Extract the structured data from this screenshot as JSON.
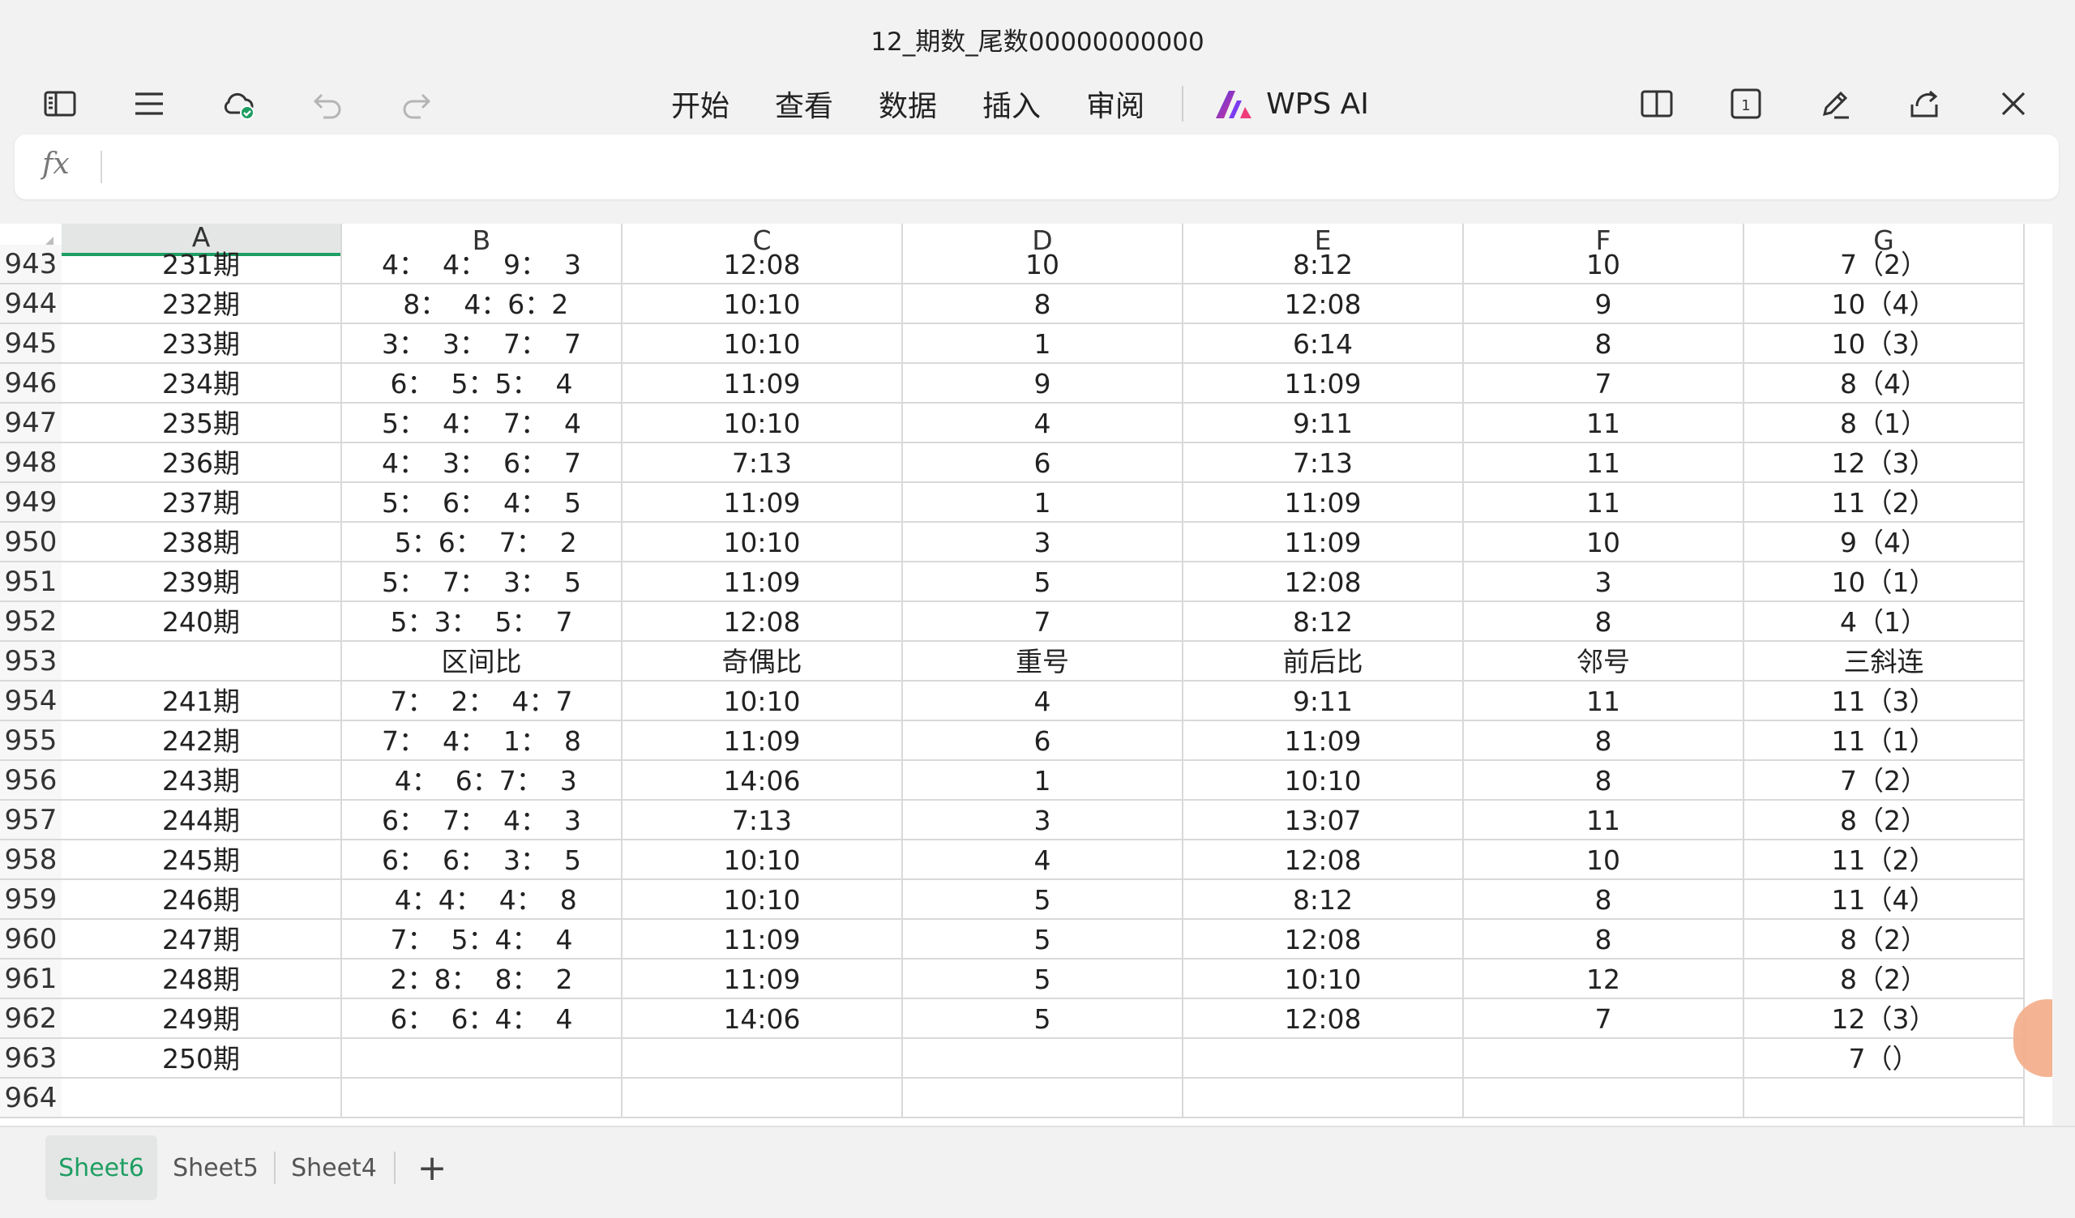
{
  "title": "12_期数_尾数00000000000",
  "toolbar": {
    "left_icons": [
      "sidebar-icon",
      "menu-icon",
      "cloud-sync-icon",
      "undo-icon",
      "redo-icon"
    ],
    "menu": [
      "开始",
      "查看",
      "数据",
      "插入",
      "审阅"
    ],
    "ai_label": "WPS AI",
    "right_icons": [
      "split-view-icon",
      "page-count-icon",
      "edit-pen-icon",
      "share-icon",
      "close-icon"
    ],
    "page_count": "1",
    "accent": "#1e9e63"
  },
  "formula_bar": {
    "fx_label": "fx",
    "value": ""
  },
  "columns": [
    "A",
    "B",
    "C",
    "D",
    "E",
    "F",
    "G"
  ],
  "active_column": "A",
  "rows": [
    {
      "n": "943",
      "cells": [
        "231期",
        "4：  4：  9：  3",
        "12:08",
        "10",
        "8:12",
        "10",
        "7（2）"
      ]
    },
    {
      "n": "944",
      "cells": [
        "232期",
        " 8：  4：6：2",
        "10:10",
        "8",
        "12:08",
        "9",
        "10（4）"
      ]
    },
    {
      "n": "945",
      "cells": [
        "233期",
        "3：  3：  7：  7",
        "10:10",
        "1",
        "6:14",
        "8",
        "10（3）"
      ]
    },
    {
      "n": "946",
      "cells": [
        "234期",
        "6：  5：5：  4",
        "11:09",
        "9",
        "11:09",
        "7",
        "8（4）"
      ]
    },
    {
      "n": "947",
      "cells": [
        "235期",
        "5：  4：  7：  4",
        "10:10",
        "4",
        "9:11",
        "11",
        "8（1）"
      ]
    },
    {
      "n": "948",
      "cells": [
        "236期",
        "4：  3：  6：  7",
        "7:13",
        "6",
        "7:13",
        "11",
        "12（3）"
      ]
    },
    {
      "n": "949",
      "cells": [
        "237期",
        "5：  6：  4：  5",
        "11:09",
        "1",
        "11:09",
        "11",
        "11（2）"
      ]
    },
    {
      "n": "950",
      "cells": [
        "238期",
        " 5：6：  7：  2",
        "10:10",
        "3",
        "11:09",
        "10",
        "9（4）"
      ]
    },
    {
      "n": "951",
      "cells": [
        "239期",
        "5：  7：  3：  5",
        "11:09",
        "5",
        "12:08",
        "3",
        "10（1）"
      ]
    },
    {
      "n": "952",
      "cells": [
        "240期",
        "5：3：  5：  7",
        "12:08",
        "7",
        "8:12",
        "8",
        "4（1）"
      ]
    },
    {
      "n": "953",
      "cells": [
        "",
        "区间比",
        "奇偶比",
        "重号",
        "前后比",
        "邻号",
        "三斜连"
      ]
    },
    {
      "n": "954",
      "cells": [
        "241期",
        "7：  2：  4：7",
        "10:10",
        "4",
        "9:11",
        "11",
        "11（3）"
      ]
    },
    {
      "n": "955",
      "cells": [
        "242期",
        "7：  4：  1：  8",
        "11:09",
        "6",
        "11:09",
        "8",
        "11（1）"
      ]
    },
    {
      "n": "956",
      "cells": [
        "243期",
        " 4：  6：7：  3",
        "14:06",
        "1",
        "10:10",
        "8",
        "7（2）"
      ]
    },
    {
      "n": "957",
      "cells": [
        "244期",
        "6：  7：  4：  3",
        "7:13",
        "3",
        "13:07",
        "11",
        "8（2）"
      ]
    },
    {
      "n": "958",
      "cells": [
        "245期",
        "6：  6：  3：  5",
        "10:10",
        "4",
        "12:08",
        "10",
        "11（2）"
      ]
    },
    {
      "n": "959",
      "cells": [
        "246期",
        " 4：4：  4：  8",
        "10:10",
        "5",
        "8:12",
        "8",
        "11（4）"
      ]
    },
    {
      "n": "960",
      "cells": [
        "247期",
        "7：  5：4：  4",
        "11:09",
        "5",
        "12:08",
        "8",
        "8（2）"
      ]
    },
    {
      "n": "961",
      "cells": [
        "248期",
        "2：8：  8：  2",
        "11:09",
        "5",
        "10:10",
        "12",
        "8（2）"
      ]
    },
    {
      "n": "962",
      "cells": [
        "249期",
        "6：  6：4：  4",
        "14:06",
        "5",
        "12:08",
        "7",
        "12（3）"
      ]
    },
    {
      "n": "963",
      "cells": [
        "250期",
        "",
        "",
        "",
        "",
        "",
        "7（）"
      ]
    },
    {
      "n": "964",
      "cells": [
        "",
        "",
        "",
        "",
        "",
        "",
        ""
      ]
    }
  ],
  "sheets": [
    {
      "name": "Sheet6",
      "active": true
    },
    {
      "name": "Sheet5",
      "active": false
    },
    {
      "name": "Sheet4",
      "active": false
    }
  ],
  "add_sheet_label": "+"
}
